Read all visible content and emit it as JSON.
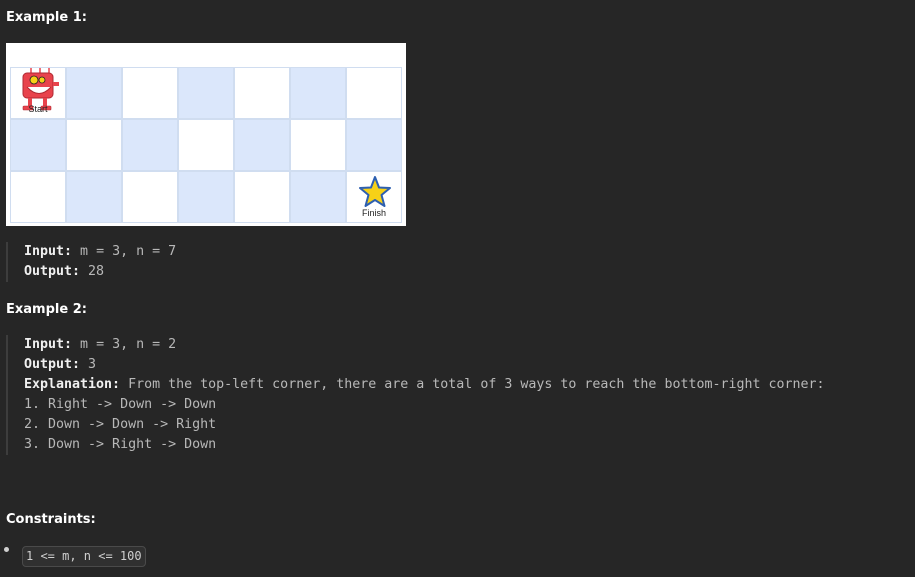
{
  "example1": {
    "heading": "Example 1:",
    "grid": {
      "rows": 3,
      "cols": 7,
      "start_label": "Start",
      "finish_label": "Finish",
      "colors": {
        "blue": "#dbe7fb",
        "white": "#ffffff",
        "star": "#f7d117",
        "robot": "#e8434c"
      }
    },
    "input_label": "Input:",
    "input_value": " m = 3, n = 7",
    "output_label": "Output:",
    "output_value": " 28"
  },
  "example2": {
    "heading": "Example 2:",
    "input_label": "Input:",
    "input_value": " m = 3, n = 2",
    "output_label": "Output:",
    "output_value": " 3",
    "explanation_label": "Explanation:",
    "explanation_value": " From the top-left corner, there are a total of 3 ways to reach the bottom-right corner:",
    "steps": [
      "1. Right -> Down -> Down",
      "2. Down -> Down -> Right",
      "3. Down -> Right -> Down"
    ]
  },
  "constraints": {
    "heading": "Constraints:",
    "items": [
      "1 <= m, n <= 100"
    ]
  }
}
